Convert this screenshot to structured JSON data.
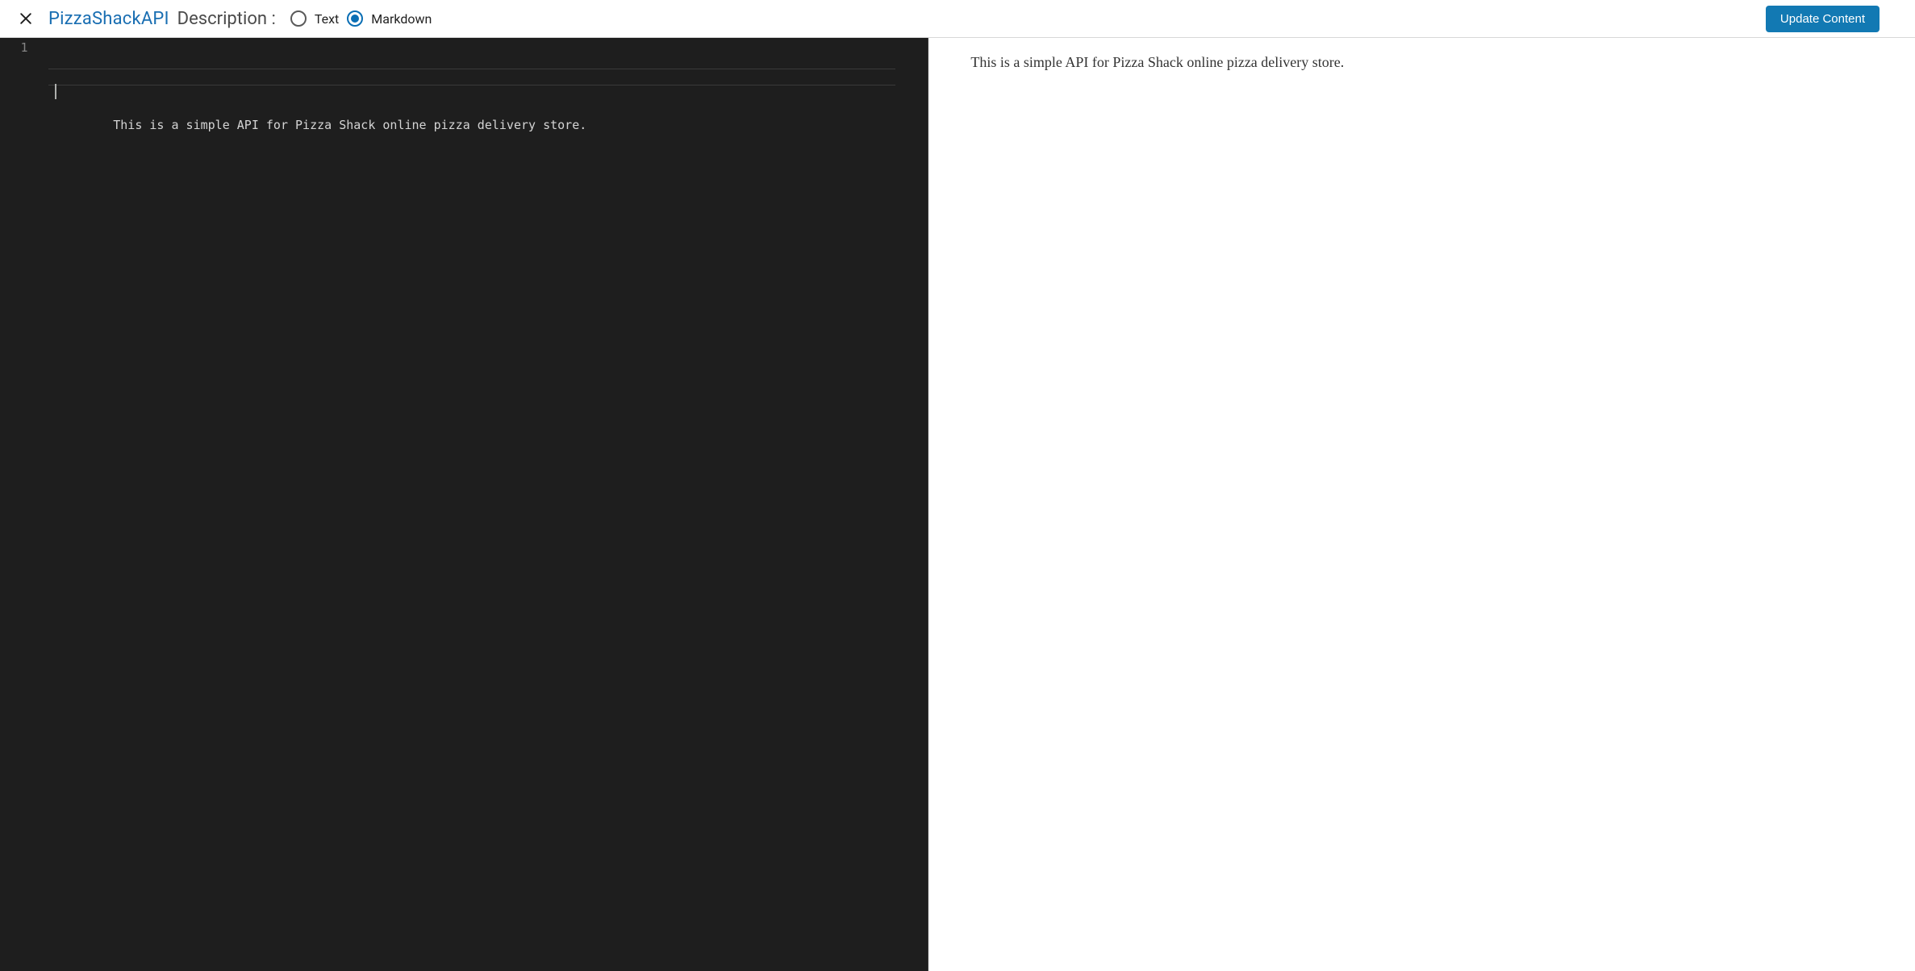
{
  "header": {
    "api_name": "PizzaShackAPI",
    "section_label": "Description :",
    "radios": {
      "text": {
        "label": "Text",
        "selected": false
      },
      "markdown": {
        "label": "Markdown",
        "selected": true
      }
    },
    "update_button": "Update Content"
  },
  "editor": {
    "lines": [
      {
        "number": "1",
        "text": "This is a simple API for Pizza Shack online pizza delivery store."
      }
    ]
  },
  "preview": {
    "rendered": "This is a simple API for Pizza Shack online pizza delivery store."
  }
}
